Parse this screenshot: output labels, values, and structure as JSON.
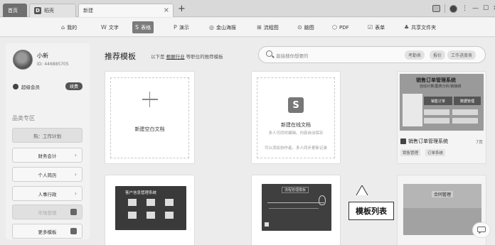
{
  "tabs": [
    {
      "label": "首页"
    },
    {
      "label": "稻壳"
    },
    {
      "label": "新建"
    }
  ],
  "window": {
    "min": "—",
    "max": "☐",
    "close": "✕",
    "plus": "+",
    "close_tab": "×"
  },
  "toolbar": [
    {
      "label": "我的",
      "icon": "⌂"
    },
    {
      "label": "文字",
      "icon": "W"
    },
    {
      "label": "表格",
      "icon": "S"
    },
    {
      "label": "演示",
      "icon": "P"
    },
    {
      "label": "金山海报",
      "icon": "◎"
    },
    {
      "label": "流程图",
      "icon": "⊞"
    },
    {
      "label": "脑图",
      "icon": "⊙"
    },
    {
      "label": "PDF",
      "icon": "⬡"
    },
    {
      "label": "表单",
      "icon": "☑"
    },
    {
      "label": "共享文件夹",
      "icon": "♣"
    }
  ],
  "user": {
    "name": "小新",
    "id": "ID: 446885705",
    "member_label": "超级会员",
    "renew_label": "续费"
  },
  "zone": {
    "title": "品类专区",
    "items": [
      {
        "label": "热：工作计划"
      },
      {
        "label": "财务会计"
      },
      {
        "label": "个人简历"
      },
      {
        "label": "人事行政"
      },
      {
        "label": "市场营销"
      },
      {
        "label": "更多模板"
      }
    ]
  },
  "recommend": {
    "title": "推荐模板",
    "sub_prefix": "以下是",
    "sub_link": "根据行业",
    "sub_suffix": "等职位的推荐模板"
  },
  "search": {
    "placeholder": "直接搜你想要的",
    "chips": [
      "考勤表",
      "报价",
      "工作进度表"
    ]
  },
  "cards": {
    "blank": {
      "label": "新建空白文档"
    },
    "online": {
      "label": "新建在线文档",
      "note1": "多人可同时编辑，内容自动保存",
      "note2": "可以添加协作者，多人同步更新记录"
    },
    "sales": {
      "label": "销售订单管理系统",
      "pages": "7页",
      "tags": [
        "销售管理",
        "订单系统"
      ],
      "thumb_title": "销售订单管理系统",
      "thumb_sub": "自动计算/图表分析/链接跳",
      "thumb_box1": "销售订单",
      "thumb_box2": "数据管理"
    },
    "customer": {
      "thumb_title": "客户信息管理系统"
    },
    "process": {
      "thumb_title": "流程管理模板"
    },
    "contract": {
      "thumb_title": "合同管理"
    }
  },
  "callout": {
    "label": "模板列表"
  },
  "colors": {
    "active_tool": "#7c7c7c",
    "page_bg": "#ececec"
  }
}
